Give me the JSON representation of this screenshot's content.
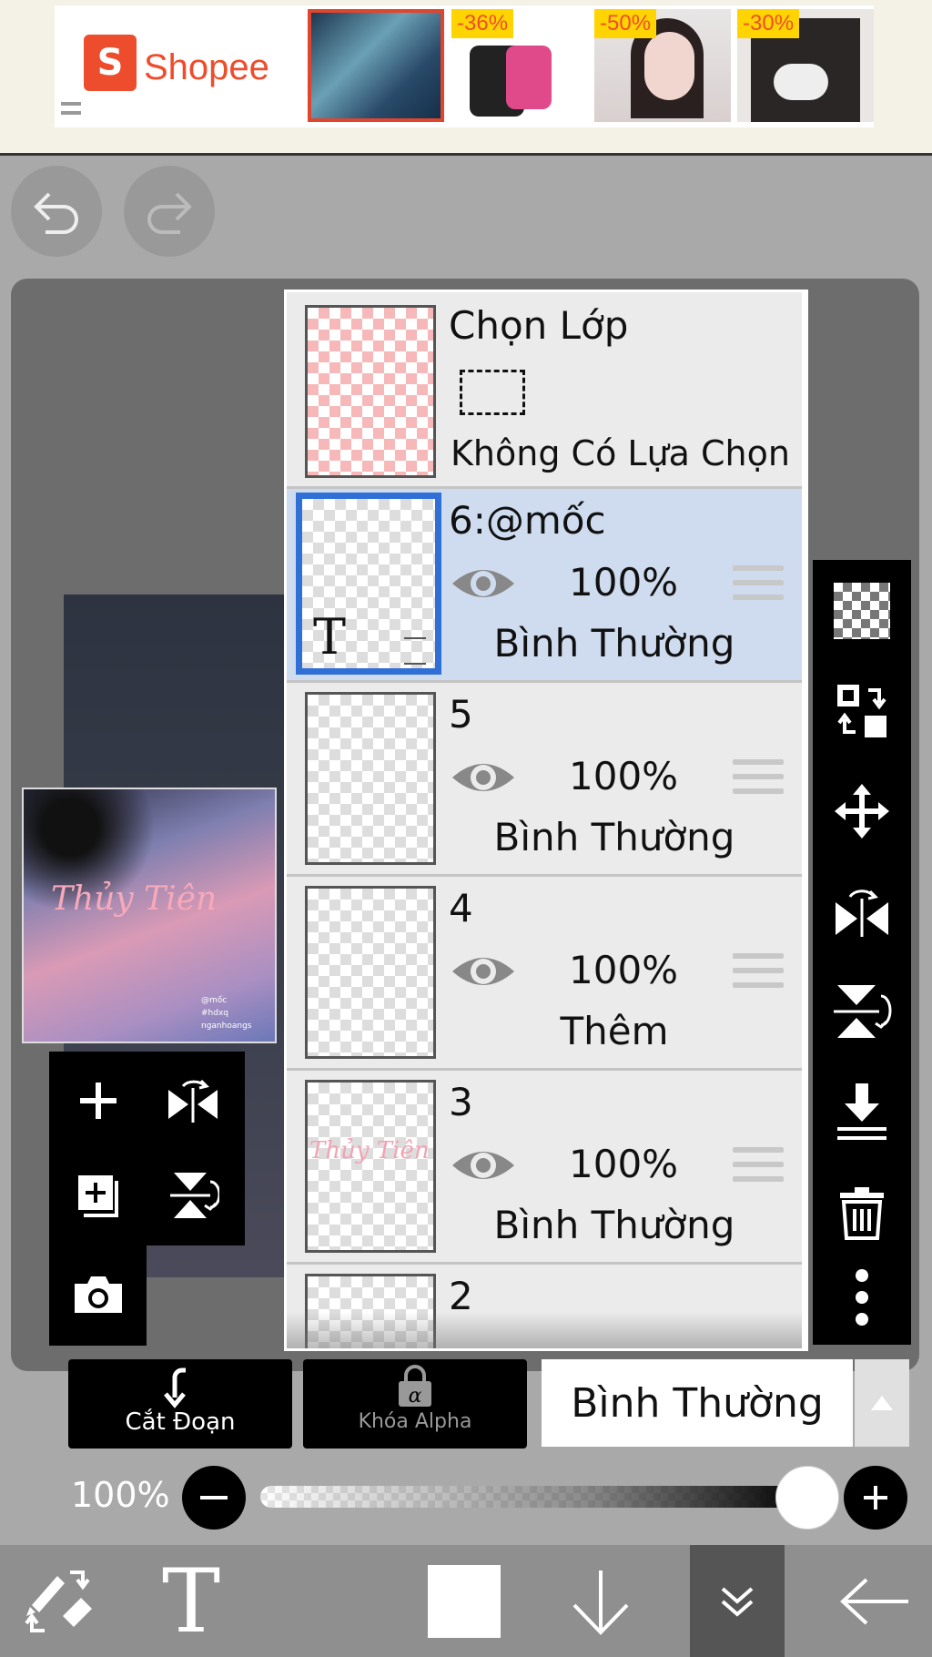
{
  "ad": {
    "brand": "Shopee",
    "discounts": [
      "-36%",
      "-50%",
      "-30%"
    ]
  },
  "layers_panel": {
    "selection": {
      "title": "Chọn Lớp",
      "status": "Không Có Lựa Chọn"
    },
    "layers": [
      {
        "name": "6:@mốc",
        "opacity": "100%",
        "blend": "Bình Thường",
        "selected": true
      },
      {
        "name": "5",
        "opacity": "100%",
        "blend": "Bình Thường",
        "selected": false
      },
      {
        "name": "4",
        "opacity": "100%",
        "blend": "Thêm",
        "selected": false
      },
      {
        "name": "3",
        "opacity": "100%",
        "blend": "Bình Thường",
        "selected": false
      },
      {
        "name": "2"
      }
    ]
  },
  "controls": {
    "clip_label": "Cắt Đoạn",
    "alpha_lock_label": "Khóa Alpha",
    "blend_mode": "Bình Thường",
    "opacity_label": "100%"
  },
  "thumbnail": {
    "title": "Thủy Tiên",
    "small_lines": [
      "@mốc",
      "#hdxq",
      "nganhoangs"
    ]
  },
  "colors": {
    "accent_blue": "#2f6fd6",
    "shopee_orange": "#ee4d2d",
    "selected_layer_bg": "#cfdcef"
  },
  "icons": {
    "top": [
      "undo-icon",
      "redo-icon"
    ],
    "left_tools": [
      "add-layer-icon",
      "flip-horizontal-icon",
      "duplicate-layer-icon",
      "flip-vertical-icon",
      "camera-icon"
    ],
    "right_tools": [
      "transparency-icon",
      "swap-layers-icon",
      "move-icon",
      "flip-h-icon",
      "flip-v-icon",
      "merge-down-icon",
      "trash-icon",
      "more-icon"
    ],
    "bottom": [
      "edit-tools-icon",
      "text-tool-icon",
      "color-swatch-icon",
      "down-arrow-icon",
      "collapse-icon",
      "back-icon"
    ]
  }
}
